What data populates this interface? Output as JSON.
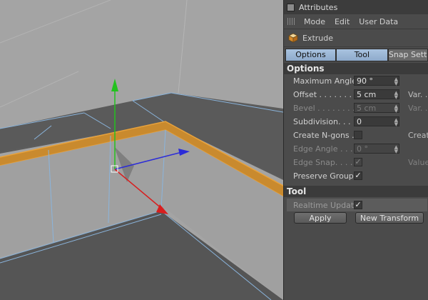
{
  "panel": {
    "title": "Attributes",
    "menu": [
      "Mode",
      "Edit",
      "User Data"
    ],
    "object_name": "Extrude",
    "tabs": [
      "Options",
      "Tool",
      "Snap Setti"
    ],
    "options_header": "Options",
    "fields": {
      "max_angle_label": "Maximum Angle",
      "max_angle_value": "90 °",
      "offset_label": "Offset . . . . . . . .",
      "offset_value": "5 cm",
      "offset_extra": "Var. .",
      "bevel_label": "Bevel . . . . . . . . .",
      "bevel_value": "5 cm",
      "bevel_extra": "Var. .",
      "subdivision_label": "Subdivision. . . .",
      "subdivision_value": "0",
      "create_ngons_label": "Create N-gons .",
      "create_ngons_extra": "Create",
      "edge_angle_label": "Edge Angle . . .",
      "edge_angle_value": "0 °",
      "edge_snap_label": "Edge Snap. . . .",
      "edge_snap_extra": "Value",
      "preserve_groups_label": "Preserve Groups"
    },
    "tool_header": "Tool",
    "realtime_update_label": "Realtime Update",
    "apply_label": "Apply",
    "new_transform_label": "New Transform",
    "colors": {
      "tab_active": "#9bb6d6",
      "selection_edge": "#e8a23c",
      "axis_y": "#22c21e",
      "axis_x": "#d81e1e",
      "axis_z": "#2b2bd8"
    }
  }
}
